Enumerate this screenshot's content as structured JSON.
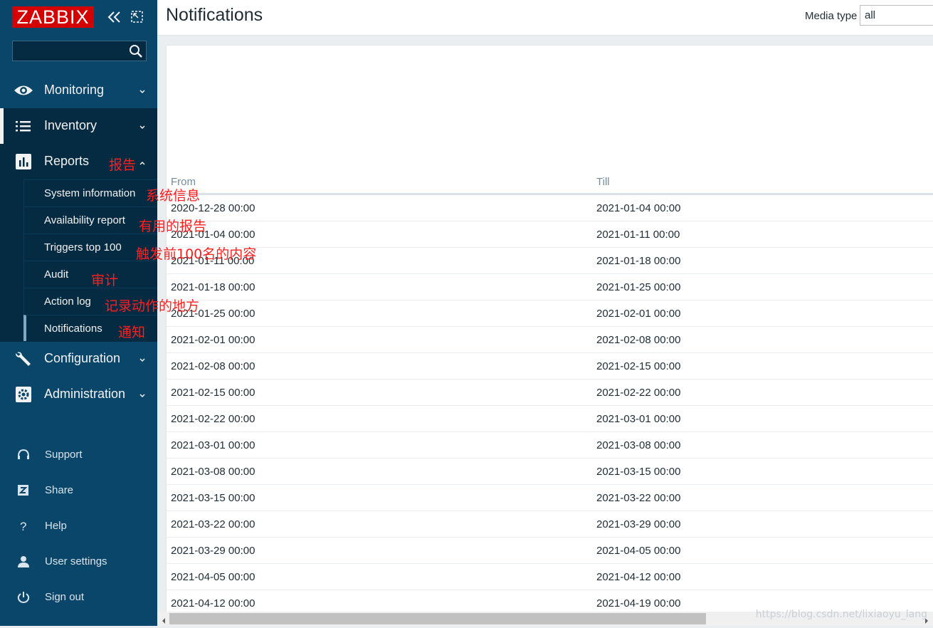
{
  "brand": {
    "logo_text": "ZABBIX"
  },
  "sidebar": {
    "search_placeholder": "",
    "menu": [
      {
        "label": "Monitoring",
        "icon": "eye-icon"
      },
      {
        "label": "Inventory",
        "icon": "list-icon"
      },
      {
        "label": "Reports",
        "icon": "bar-chart-icon"
      },
      {
        "label": "Configuration",
        "icon": "wrench-icon"
      },
      {
        "label": "Administration",
        "icon": "gear-icon"
      }
    ],
    "reports_submenu": [
      {
        "label": "System information"
      },
      {
        "label": "Availability report"
      },
      {
        "label": "Triggers top 100"
      },
      {
        "label": "Audit"
      },
      {
        "label": "Action log"
      },
      {
        "label": "Notifications"
      }
    ],
    "footer": [
      {
        "label": "Support",
        "icon": "headset-icon"
      },
      {
        "label": "Share",
        "icon": "share-z-icon"
      },
      {
        "label": "Help",
        "icon": "help-icon"
      },
      {
        "label": "User settings",
        "icon": "user-icon"
      },
      {
        "label": "Sign out",
        "icon": "power-icon"
      }
    ]
  },
  "annotations": {
    "reports": "报告",
    "system_information": "系统信息",
    "availability_report": "有用的报告",
    "triggers_top": "触发前100名的内容",
    "audit": "审计",
    "action_log": "记录动作的地方",
    "notifications": "通知"
  },
  "header": {
    "title": "Notifications",
    "media_type_label": "Media type",
    "media_type_value": "all"
  },
  "table": {
    "columns": [
      "From",
      "Till"
    ],
    "rows": [
      [
        "2020-12-28 00:00",
        "2021-01-04 00:00"
      ],
      [
        "2021-01-04 00:00",
        "2021-01-11 00:00"
      ],
      [
        "2021-01-11 00:00",
        "2021-01-18 00:00"
      ],
      [
        "2021-01-18 00:00",
        "2021-01-25 00:00"
      ],
      [
        "2021-01-25 00:00",
        "2021-02-01 00:00"
      ],
      [
        "2021-02-01 00:00",
        "2021-02-08 00:00"
      ],
      [
        "2021-02-08 00:00",
        "2021-02-15 00:00"
      ],
      [
        "2021-02-15 00:00",
        "2021-02-22 00:00"
      ],
      [
        "2021-02-22 00:00",
        "2021-03-01 00:00"
      ],
      [
        "2021-03-01 00:00",
        "2021-03-08 00:00"
      ],
      [
        "2021-03-08 00:00",
        "2021-03-15 00:00"
      ],
      [
        "2021-03-15 00:00",
        "2021-03-22 00:00"
      ],
      [
        "2021-03-22 00:00",
        "2021-03-29 00:00"
      ],
      [
        "2021-03-29 00:00",
        "2021-04-05 00:00"
      ],
      [
        "2021-04-05 00:00",
        "2021-04-12 00:00"
      ],
      [
        "2021-04-12 00:00",
        "2021-04-19 00:00"
      ]
    ]
  },
  "watermark": "https://blog.csdn.net/lixiaoyu_lang",
  "colors": {
    "sidebar": "#0a466a",
    "sidebar_dark": "#052b42",
    "logo": "#d40000",
    "annotation": "#ff1f1f"
  }
}
